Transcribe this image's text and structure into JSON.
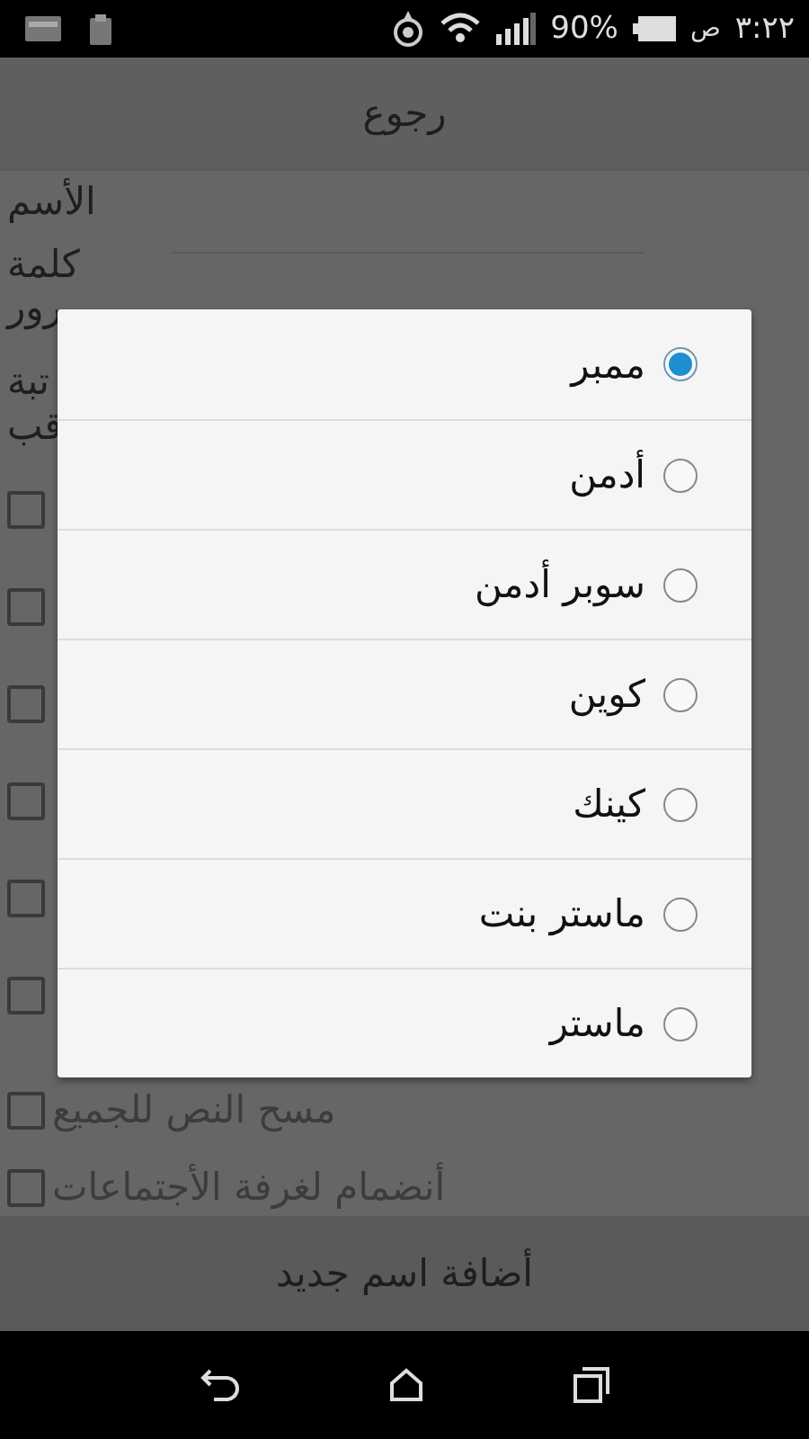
{
  "status_bar": {
    "time": "٣:٢٢",
    "am_pm": "ص",
    "battery": "90%"
  },
  "back_button": "رجوع",
  "form": {
    "labels": [
      "الأسم",
      "كلمة",
      "رور",
      "تبة",
      "قب"
    ],
    "checkboxes": [
      {
        "checked": false
      },
      {
        "checked": false
      },
      {
        "checked": false
      },
      {
        "checked": false
      },
      {
        "checked": false
      },
      {
        "checked": false
      },
      {
        "label": "مسح النص للجميع",
        "checked": false
      },
      {
        "label": "أنضمام لغرفة الأجتماعات",
        "checked": false
      }
    ]
  },
  "dialog": {
    "options": [
      {
        "label": "ممبر",
        "selected": true
      },
      {
        "label": "أدمن",
        "selected": false
      },
      {
        "label": "سوبر أدمن",
        "selected": false
      },
      {
        "label": "كوين",
        "selected": false
      },
      {
        "label": "كينك",
        "selected": false
      },
      {
        "label": "ماستر بنت",
        "selected": false
      },
      {
        "label": "ماستر",
        "selected": false
      }
    ]
  },
  "add_button": "أضافة اسم جديد"
}
